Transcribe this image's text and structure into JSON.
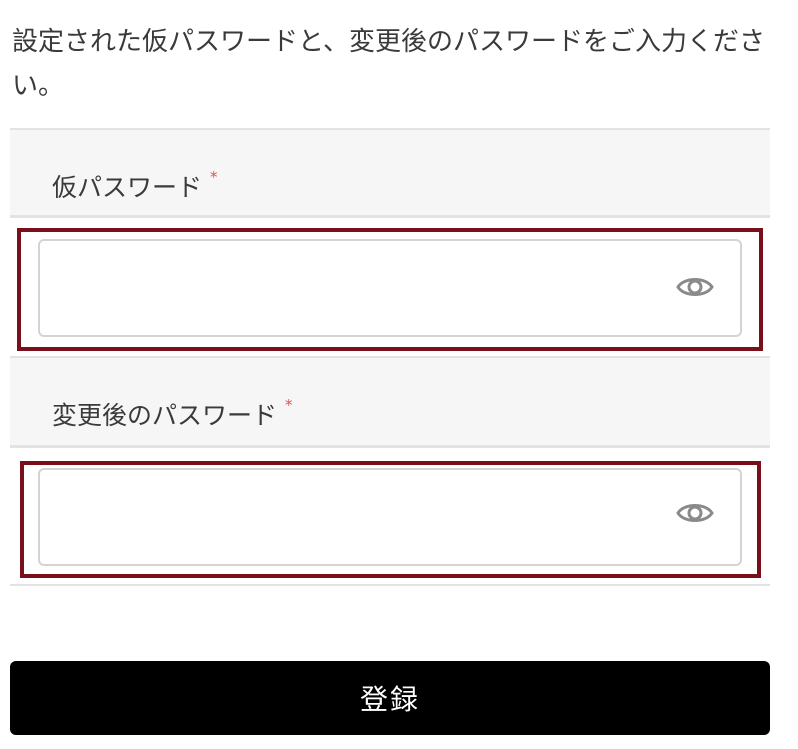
{
  "instruction": "設定された仮パスワードと、変更後のパスワードをご入力ください。",
  "fields": [
    {
      "label": "仮パスワード",
      "required_mark": "*",
      "value": "",
      "placeholder": "",
      "toggle_icon": "eye-icon"
    },
    {
      "label": "変更後のパスワード",
      "required_mark": "*",
      "value": "",
      "placeholder": "",
      "toggle_icon": "eye-icon"
    }
  ],
  "submit_label": "登録",
  "colors": {
    "highlight_border": "#7a0f1c",
    "required_mark": "#d9534f",
    "button_bg": "#000000",
    "button_text": "#ffffff",
    "section_bg": "#f6f6f6"
  }
}
